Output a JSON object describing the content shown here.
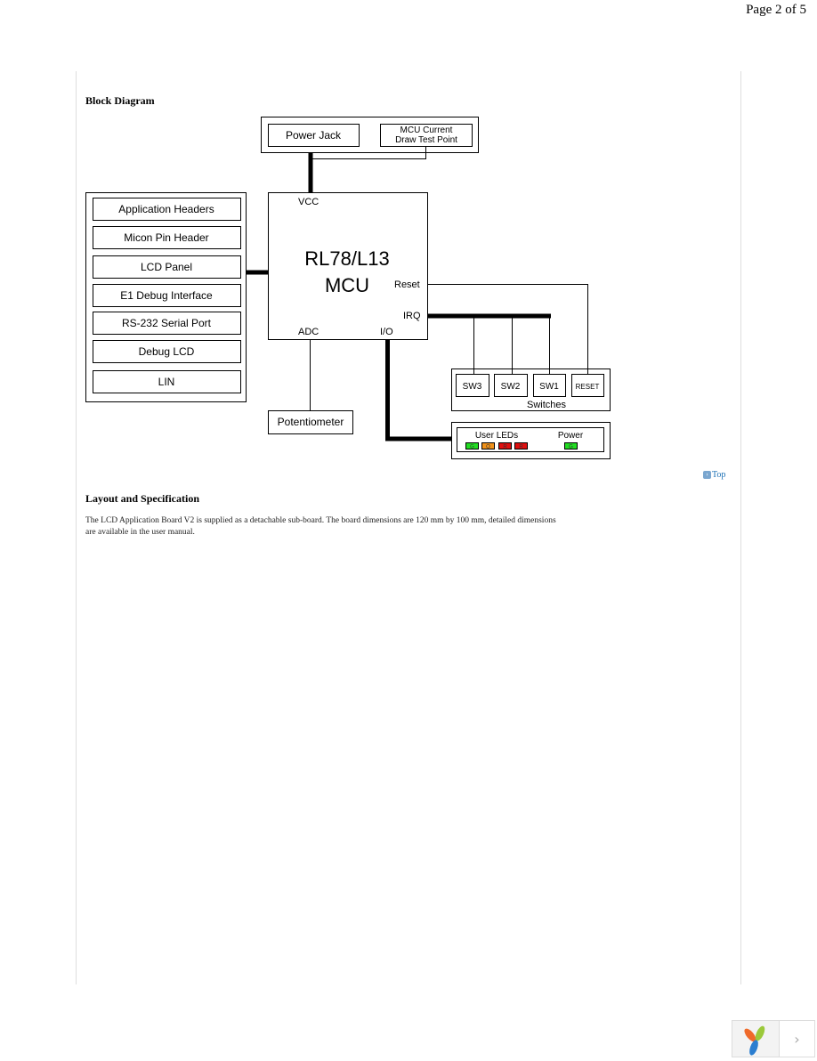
{
  "page_number": "Page 2 of 5",
  "sections": {
    "block_diagram_heading": "Block Diagram",
    "layout_heading": "Layout and Specification",
    "layout_text": "The LCD Application Board V2 is supplied as a detachable sub-board. The board dimensions are 120 mm by 100 mm, detailed dimensions are available in the user manual.",
    "top_link": "Top"
  },
  "diagram": {
    "power_jack": "Power Jack",
    "mcu_current_1": "MCU Current",
    "mcu_current_2": "Draw Test Point",
    "mcu_title": "RL78/L13",
    "mcu_sub": "MCU",
    "vcc": "VCC",
    "reset": "Reset",
    "irq": "IRQ",
    "adc": "ADC",
    "io": "I/O",
    "peripherals": [
      "Application Headers",
      "Micon Pin Header",
      "LCD Panel",
      "E1 Debug Interface",
      "RS-232 Serial Port",
      "Debug LCD",
      "LIN"
    ],
    "potentiometer": "Potentiometer",
    "switches": [
      "SW3",
      "SW2",
      "SW1",
      "RESET"
    ],
    "switches_label": "Switches",
    "user_leds_label": "User LEDs",
    "power_label": "Power",
    "user_leds": [
      {
        "label": "G",
        "color": "#22dd22"
      },
      {
        "label": "O",
        "color": "#f0921c"
      },
      {
        "label": "R",
        "color": "#e01010"
      },
      {
        "label": "R",
        "color": "#e01010"
      }
    ],
    "power_led": {
      "label": "G",
      "color": "#22dd22"
    }
  },
  "nav": {
    "next_icon": "chevron-right-icon",
    "logo": "pinwheel-logo"
  }
}
